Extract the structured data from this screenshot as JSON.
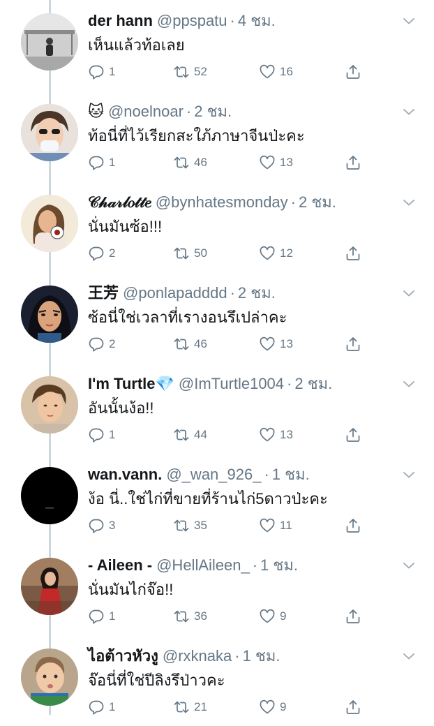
{
  "tweets": [
    {
      "name": "der hann",
      "handle": "@ppspatu",
      "time": "4 ชม.",
      "text": "เห็นแล้วท้อเลย",
      "replies": "1",
      "retweets": "52",
      "likes": "16"
    },
    {
      "name": "🐱",
      "handle": "@noelnoar",
      "time": "2 ชม.",
      "text": "ท้อนี่ที่ไว้เรียกสะใภ้ภาษาจีนป่ะคะ",
      "replies": "1",
      "retweets": "46",
      "likes": "13"
    },
    {
      "name": "𝒞𝒽𝒶𝓇𝓁𝑜𝓉𝓉𝑒",
      "handle": "@bynhatesmonday",
      "time": "2 ชม.",
      "text": "นั่นมันซ้อ!!!",
      "replies": "2",
      "retweets": "50",
      "likes": "12"
    },
    {
      "name": "王芳",
      "handle": "@ponlapadddd",
      "time": "2 ชม.",
      "text": "ซ้อนี่ใช่เวลาที่เรางอนรึเปล่าคะ",
      "replies": "2",
      "retweets": "46",
      "likes": "13"
    },
    {
      "name": "I'm Turtle💎",
      "handle": "@ImTurtle1004",
      "time": "2 ชม.",
      "text": "อันนั้นง้อ!!",
      "replies": "1",
      "retweets": "44",
      "likes": "13"
    },
    {
      "name": "wan.vann.",
      "handle": "@_wan_926_",
      "time": "1 ชม.",
      "text": "ง้อ นี่..ใช่ไก่ที่ขายที่ร้านไก่5ดาวป่ะคะ",
      "replies": "3",
      "retweets": "35",
      "likes": "11"
    },
    {
      "name": "- Aileen -",
      "handle": "@HellAileen_",
      "time": "1 ชม.",
      "text": "นั่นมันไก่จ๊อ!!",
      "replies": "1",
      "retweets": "36",
      "likes": "9"
    },
    {
      "name": "ไอต้าวหัวงู",
      "handle": "@rxknaka",
      "time": "1 ชม.",
      "text": "จ๊อนี่ที่ใช่ปีลิงรึป่าวคะ",
      "replies": "1",
      "retweets": "21",
      "likes": "9"
    }
  ],
  "colors": {
    "text": "#14171a",
    "secondary": "#657786",
    "thread_line": "#ccd6dd",
    "background": "#ffffff"
  },
  "icons": {
    "reply": "reply-icon",
    "retweet": "retweet-icon",
    "like": "like-icon",
    "share": "share-icon",
    "more": "chevron-down-icon"
  }
}
